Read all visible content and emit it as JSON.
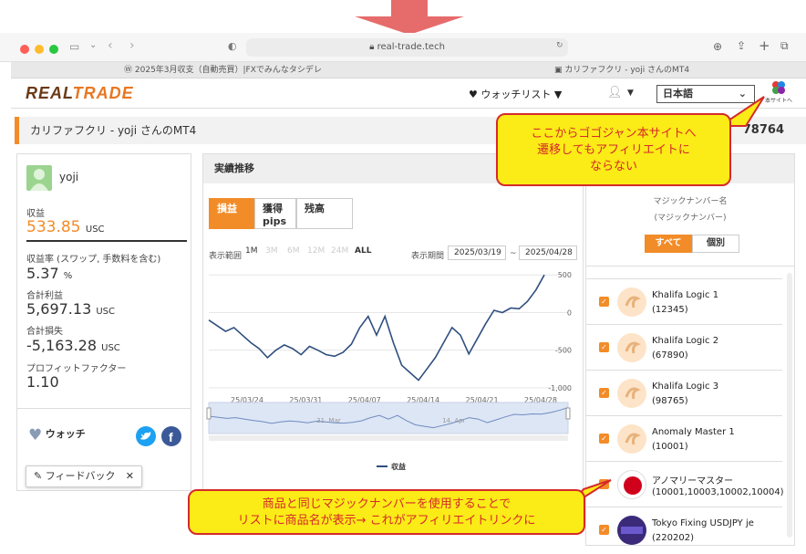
{
  "browser": {
    "url": "real-trade.tech",
    "tabs": [
      "2025年3月収支（自動売買）|FXでみんなタシデレ",
      "カリファフクリ - yoji さんのMT4"
    ]
  },
  "header": {
    "logo_a": "REAL",
    "logo_b": "TRADE",
    "watchlist_label": "ウォッチリスト",
    "language": "日本語",
    "site_link": "本サイトへ"
  },
  "title_bar": {
    "title": "カリファフクリ - yoji さんのMT4",
    "number": "78764"
  },
  "profile": {
    "username": "yoji",
    "profit_label": "収益",
    "profit_value": "533.85",
    "currency": "USC",
    "roi_label": "収益率 (スワップ, 手数料を含む)",
    "roi_value": "5.37",
    "roi_unit": "%",
    "total_profit_label": "合計利益",
    "total_profit_value": "5,697.13",
    "total_loss_label": "合計損失",
    "total_loss_value": "-5,163.28",
    "pf_label": "プロフィットファクター",
    "pf_value": "1.10",
    "watch_label": "ウォッチ",
    "feedback_label": "フィードバック"
  },
  "performance": {
    "heading": "実績推移",
    "tabs": [
      "損益",
      "獲得\npips",
      "残高"
    ],
    "range_label": "表示範囲",
    "ranges": [
      "1M",
      "3M",
      "6M",
      "12M",
      "24M",
      "ALL"
    ],
    "period_label": "表示期間",
    "date_from": "2025/03/19",
    "date_sep": "~",
    "date_to": "2025/04/28",
    "navigator_labels": [
      "31. Mar",
      "14. Apr"
    ]
  },
  "chart_data": {
    "type": "line",
    "x_tick_labels": [
      "25/03/24",
      "25/03/31",
      "25/04/07",
      "25/04/14",
      "25/04/21",
      "25/04/28"
    ],
    "y_tick_labels": [
      "500",
      "0",
      "-500",
      "-1,000"
    ],
    "ylim": [
      -1000,
      500
    ],
    "series": [
      {
        "name": "収益",
        "x": [
          0,
          2,
          3,
          4,
          5,
          6,
          7,
          8,
          9,
          10,
          11,
          12,
          13,
          14,
          15,
          16,
          17,
          18,
          19,
          20,
          21,
          22,
          23,
          24,
          25,
          26,
          27,
          28,
          29,
          30,
          31,
          32,
          33,
          34,
          35,
          36,
          37,
          38,
          39,
          40
        ],
        "values": [
          -100,
          -250,
          -200,
          -300,
          -400,
          -480,
          -600,
          -500,
          -430,
          -480,
          -560,
          -450,
          -500,
          -560,
          -580,
          -530,
          -420,
          -200,
          -50,
          -300,
          -50,
          -400,
          -700,
          -800,
          -900,
          -750,
          -600,
          -400,
          -200,
          -300,
          -550,
          -350,
          -150,
          30,
          0,
          60,
          50,
          150,
          300,
          500
        ]
      }
    ],
    "x_start": "2025/03/19",
    "legend": "bottom",
    "grid": true
  },
  "magic_panel": {
    "heading_a": "マジックナンバー名",
    "heading_b": "(マジックナンバー)",
    "toggle_all": "すべて",
    "toggle_single": "個別",
    "items": [
      {
        "name": "Khalifa Logic 1",
        "number": "(12345)"
      },
      {
        "name": "Khalifa Logic 2",
        "number": "(67890)"
      },
      {
        "name": "Khalifa Logic 3",
        "number": "(98765)"
      },
      {
        "name": "Anomaly Master 1",
        "number": "(10001)"
      },
      {
        "name": "アノマリーマスター",
        "number": "(10001,10003,10002,10004)"
      },
      {
        "name": "Tokyo Fixing USDJPY je",
        "number": "(220202)"
      }
    ]
  },
  "callouts": {
    "top_line1": "ここからゴゴジャン本サイトへ",
    "top_line2": "遷移してもアフィリエイトに",
    "top_line3": "ならない",
    "bottom_line1": "商品と同じマジックナンバーを使用することで",
    "bottom_line2": "リストに商品名が表示→ これがアフィリエイトリンクに"
  },
  "colors": {
    "accent": "#f28c28",
    "arrow": "#e66b6b",
    "callout_bg": "#fbeb17",
    "callout_border": "#d52a2a",
    "line": "#2f4f7f"
  }
}
